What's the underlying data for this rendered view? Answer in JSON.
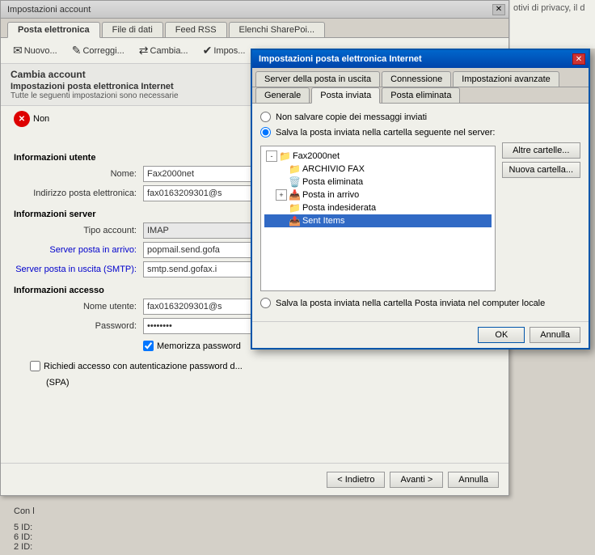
{
  "outerWindow": {
    "title": "Impostazioni account",
    "closeBtn": "✕"
  },
  "rightSideText": "otivi di privacy, il d",
  "tabs": [
    {
      "id": "posta",
      "label": "Posta elettronica",
      "active": true
    },
    {
      "id": "dati",
      "label": "File di dati",
      "active": false
    },
    {
      "id": "rss",
      "label": "Feed RSS",
      "active": false
    },
    {
      "id": "sharepoint",
      "label": "Elenchi SharePoi...",
      "active": false
    }
  ],
  "toolbar": {
    "nuovo": "Nuovo...",
    "correggi": "Correggi...",
    "cambia": "Cambia...",
    "imposta": "Impos..."
  },
  "sectionHeader": {
    "title": "Cambia account",
    "subtitle1": "Impostazioni posta elettronica Internet",
    "subtitle2": "Tutte le seguenti impostazioni sono necessarie"
  },
  "nonLabel": "Non",
  "formSections": {
    "utente": {
      "title": "Informazioni utente",
      "nomeLabel": "Nome:",
      "nomeValue": "Fax2000net",
      "emailLabel": "Indirizzo posta elettronica:",
      "emailValue": "fax0163209301@s"
    },
    "server": {
      "title": "Informazioni server",
      "tipoLabel": "Tipo account:",
      "tipoValue": "IMAP",
      "arrivoLabel": "Server posta in arrivo:",
      "arrivoValue": "popmail.send.gofa",
      "uscitaLabel": "Server posta in uscita (SMTP):",
      "uscitaValue": "smtp.send.gofax.i"
    },
    "accesso": {
      "title": "Informazioni accesso",
      "nomeUtenteLabel": "Nome utente:",
      "nomeUtenteValue": "fax0163209301@s",
      "passwordLabel": "Password:",
      "passwordValue": "••••••••",
      "memorizzaLabel": "Memorizza password"
    },
    "spa": {
      "richiedeLabel": "Richiedi accesso con autenticazione password d...",
      "spaLabel": "(SPA)"
    }
  },
  "conText": "Con l",
  "idsText": [
    "5 ID:",
    "6 ID:",
    "2 ID:"
  ],
  "bottomButtons": {
    "indietro": "< Indietro",
    "avanti": "Avanti >",
    "annulla": "Annulla"
  },
  "innerDialog": {
    "title": "Impostazioni posta elettronica Internet",
    "closeBtn": "✕",
    "tabs": {
      "row1": [
        {
          "id": "server-uscita",
          "label": "Server della posta in uscita",
          "active": false
        },
        {
          "id": "connessione",
          "label": "Connessione",
          "active": false
        },
        {
          "id": "impostazioni-avanzate",
          "label": "Impostazioni avanzate",
          "active": false
        }
      ],
      "row2": [
        {
          "id": "generale",
          "label": "Generale",
          "active": false
        },
        {
          "id": "posta-inviata",
          "label": "Posta inviata",
          "active": true
        },
        {
          "id": "posta-eliminata",
          "label": "Posta eliminata",
          "active": false
        }
      ]
    },
    "radio1": {
      "label": "Non salvare copie dei messaggi inviati",
      "selected": false
    },
    "radio2": {
      "label": "Salva la posta inviata nella cartella seguente nel server:",
      "selected": true
    },
    "folderTree": {
      "items": [
        {
          "id": "fax2000net",
          "label": "Fax2000net",
          "level": 0,
          "hasExpander": true,
          "expanded": true,
          "icon": "📁"
        },
        {
          "id": "archivio-fax",
          "label": "ARCHIVIO FAX",
          "level": 1,
          "hasExpander": false,
          "icon": "📁"
        },
        {
          "id": "posta-eliminata",
          "label": "Posta eliminata",
          "level": 1,
          "hasExpander": false,
          "icon": "🗑️"
        },
        {
          "id": "posta-in-arrivo",
          "label": "Posta in arrivo",
          "level": 1,
          "hasExpander": true,
          "expanded": false,
          "icon": "📥"
        },
        {
          "id": "posta-indesiderata",
          "label": "Posta indesiderata",
          "level": 1,
          "hasExpander": false,
          "icon": "📁"
        },
        {
          "id": "sent-items",
          "label": "Sent Items",
          "level": 1,
          "hasExpander": false,
          "icon": "📤",
          "selected": true
        }
      ]
    },
    "altreCartelle": "Altre cartelle...",
    "nuovaCartella": "Nuova cartella...",
    "radio3": {
      "label": "Salva la posta inviata nella cartella Posta inviata nel computer locale",
      "selected": false
    },
    "buttons": {
      "ok": "OK",
      "annulla": "Annulla"
    }
  }
}
